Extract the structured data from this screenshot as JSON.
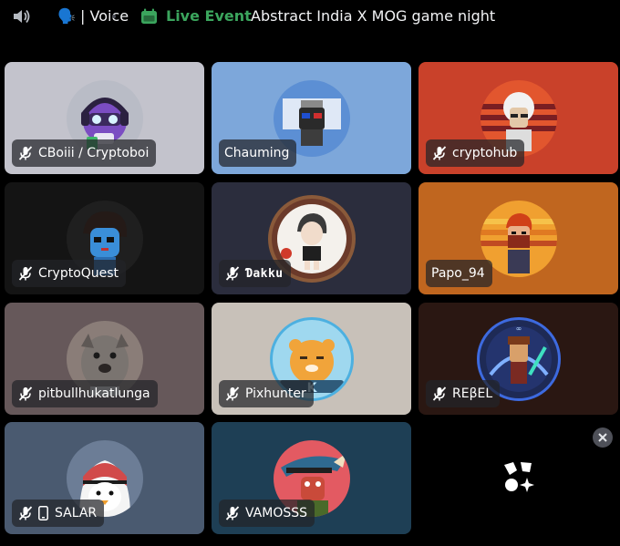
{
  "header": {
    "channel_name": "🗣️ | Voice",
    "live_label": "Live Event",
    "event_title": "Abstract India X MOG game night",
    "accent": "#3ba55d"
  },
  "tiles": [
    {
      "name": "CBoiii / Cryptoboi",
      "muted": true,
      "bg": "#c3c3cc"
    },
    {
      "name": "Chauming",
      "muted": false,
      "bg": "#7da7da"
    },
    {
      "name": "cryptohub",
      "muted": true,
      "bg": "#c9412a"
    },
    {
      "name": "CryptoQuest",
      "muted": true,
      "bg": "#141414"
    },
    {
      "name": "Ɗakku",
      "muted": true,
      "bg": "#2b2d3d"
    },
    {
      "name": "Papo_94",
      "muted": false,
      "bg": "#c0661f"
    },
    {
      "name": "pitbullhukatlunga",
      "muted": true,
      "bg": "#66585a"
    },
    {
      "name": "Pixhunter",
      "muted": true,
      "bg": "#c8c1b9"
    },
    {
      "name": "REβEL",
      "muted": true,
      "bg": "#2a1712"
    },
    {
      "name": "SALAR",
      "muted": true,
      "mobile": true,
      "bg": "#4a5a70"
    },
    {
      "name": "VAMOSSS",
      "muted": true,
      "bg": "#1e3f55"
    }
  ],
  "icons": [
    "speaker-icon",
    "calendar-icon",
    "mic-off-icon",
    "mobile-icon",
    "close-icon",
    "activity-logo-icon"
  ]
}
